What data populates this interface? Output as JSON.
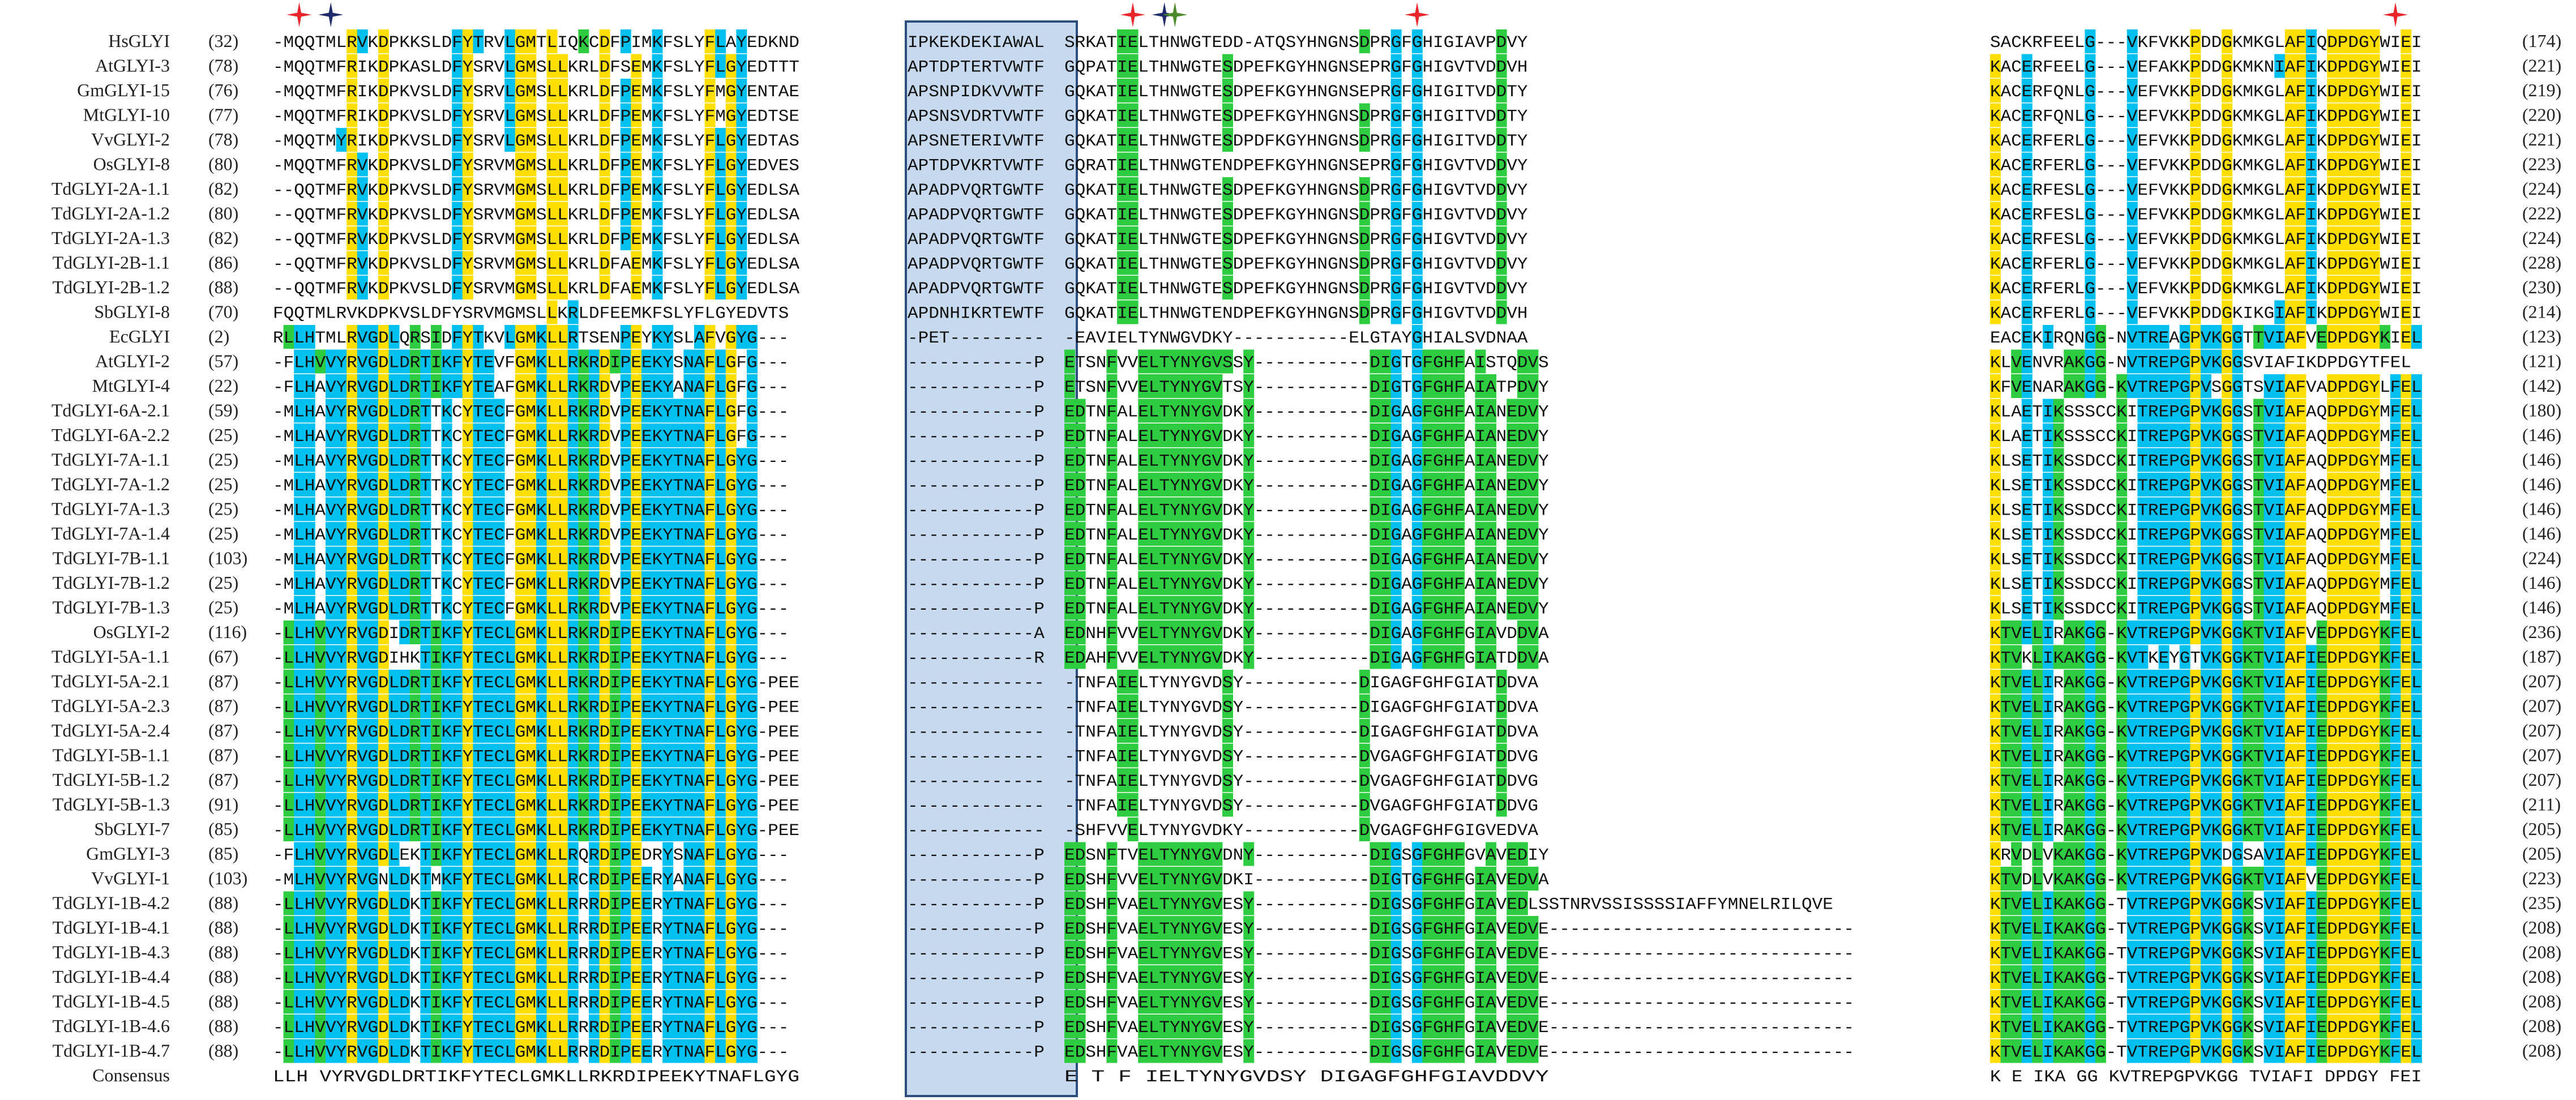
{
  "figure": {
    "labels": [
      "HsGLYI",
      "AtGLYI-3",
      "GmGLYI-15",
      "MtGLYI-10",
      "VvGLYI-2",
      "OsGLYI-8",
      "TdGLYI-2A-1.1",
      "TdGLYI-2A-1.2",
      "TdGLYI-2A-1.3",
      "TdGLYI-2B-1.1",
      "TdGLYI-2B-1.2",
      "SbGLYI-8",
      "EcGLYI",
      "AtGLYI-2",
      "MtGLYI-4",
      "TdGLYI-6A-2.1",
      "TdGLYI-6A-2.2",
      "TdGLYI-7A-1.1",
      "TdGLYI-7A-1.2",
      "TdGLYI-7A-1.3",
      "TdGLYI-7A-1.4",
      "TdGLYI-7B-1.1",
      "TdGLYI-7B-1.2",
      "TdGLYI-7B-1.3",
      "OsGLYI-2",
      "TdGLYI-5A-1.1",
      "TdGLYI-5A-2.1",
      "TdGLYI-5A-2.3",
      "TdGLYI-5A-2.4",
      "TdGLYI-5B-1.1",
      "TdGLYI-5B-1.2",
      "TdGLYI-5B-1.3",
      "SbGLYI-7",
      "GmGLYI-3",
      "VvGLYI-1",
      "TdGLYI-1B-4.2",
      "TdGLYI-1B-4.1",
      "TdGLYI-1B-4.3",
      "TdGLYI-1B-4.4",
      "TdGLYI-1B-4.5",
      "TdGLYI-1B-4.6",
      "TdGLYI-1B-4.7",
      "Consensus"
    ],
    "start_numbers": [
      "(32)",
      "(78)",
      "(76)",
      "(77)",
      "(78)",
      "(80)",
      "(82)",
      "(80)",
      "(82)",
      "(86)",
      "(88)",
      "(70)",
      "(2)",
      "(57)",
      "(22)",
      "(59)",
      "(25)",
      "(25)",
      "(25)",
      "(25)",
      "(25)",
      "(103)",
      "(25)",
      "(25)",
      "(116)",
      "(67)",
      "(87)",
      "(87)",
      "(87)",
      "(87)",
      "(87)",
      "(91)",
      "(85)",
      "(85)",
      "(103)",
      "(88)",
      "(88)",
      "(88)",
      "(88)",
      "(88)",
      "(88)",
      "(88)",
      ""
    ],
    "end_numbers": [
      "(174)",
      "(221)",
      "(219)",
      "(220)",
      "(221)",
      "(223)",
      "(224)",
      "(222)",
      "(224)",
      "(228)",
      "(230)",
      "(214)",
      "(123)",
      "(121)",
      "(142)",
      "(180)",
      "(146)",
      "(146)",
      "(146)",
      "(146)",
      "(146)",
      "(224)",
      "(146)",
      "(146)",
      "(236)",
      "(187)",
      "(207)",
      "(207)",
      "(207)",
      "(207)",
      "(207)",
      "(211)",
      "(205)",
      "(205)",
      "(223)",
      "(235)",
      "(208)",
      "(208)",
      "(208)",
      "(208)",
      "(208)",
      "(208)",
      ""
    ],
    "segments": {
      "s1": [
        "-MQQTMLRVKDPKKSLDFYTRVLGMTLIQKCDFPIMKFSLYFLAYEDKND",
        "-MQQTMFRIKDPKASLDFYSRVLGMSLLKRLDFSEMKFSLYFLGYEDTTT",
        "-MQQTMFRIKDPKVSLDFYSRVLGMSLLKRLDFPEMKFSLYFMGYENTAE",
        "-MQQTMFRIKDPKVSLDFYSRVLGMSLLKRLDFPEMKFSLYFMGYEDTSE",
        "-MQQTMYRIKDPKVSLDFYSRVLGMSLLKRLDFPEMKFSLYFLGYEDTAS",
        "-MQQTMFRVKDPKVSLDFYSRVMGMSLLKRLDFPEMKFSLYFLGYEDVES",
        "--QQTMFRVKDPKVSLDFYSRVMGMSLLKRLDFPEMKFSLYFLGYEDLSA",
        "--QQTMFRVKDPKVSLDFYSRVMGMSLLKRLDFPEMKFSLYFLGYEDLSA",
        "--QQTMFRVKDPKVSLDFYSRVMGMSLLKRLDFPEMKFSLYFLGYEDLSA",
        "--QQTMFRVKDPKVSLDFYSRVMGMSLLKRLDFAEMKFSLYFLGYEDLSA",
        "--QQTMFRVKDPKVSLDFYSRVMGMSLLKRLDFAEMKFSLYFLGYEDLSA",
        "FQQTMLRVKDPKVSLDFYSRVMGMSLLKRLDFEEMKFSLYFLGYEDVTS",
        "RLLHTMLRVGDLQRSIDFYTKVLGMKLLRTSENPEYKYSLAFVGYG---",
        "-FLHVVYRVGDLDRTIKFYTEVFGMKLLRKRDIPEEKYSNAFLGFG---",
        "-FLHAVYRVGDLDRTIKFYTEAFGMKLLRKRDVPEEKYANAFLGFG---",
        "-MLHAVYRVGDLDRTTKCYTECFGMKLLRKRDVPEEKYTNAFLGFG---",
        "-MLHAVYRVGDLDRTTKCYTECFGMKLLRKRDVPEEKYTNAFLGFG---",
        "-MLHAVYRVGDLDRTTKCYTECFGMKLLRKRDVPEEKYTNAFLGYG---",
        "-MLHAVYRVGDLDRTTKCYTECFGMKLLRKRDVPEEKYTNAFLGYG---",
        "-MLHAVYRVGDLDRTTKCYTECFGMKLLRKRDVPEEKYTNAFLGYG---",
        "-MLHAVYRVGDLDRTTKCYTECFGMKLLRKRDVPEEKYTNAFLGYG---",
        "-MLHAVYRVGDLDRTTKCYTECFGMKLLRKRDVPEEKYTNAFLGYG---",
        "-MLHAVYRVGDLDRTTKCYTECFGMKLLRKRDVPEEKYTNAFLGYG---",
        "-MLHAVYRVGDLDRTTKCYTECFGMKLLRKRDVPEEKYTNAFLGYG---",
        "-LLHVVYRVGDIDRTIKFYTECLGMKLLRKRDIPEEKYTNAFLGYG---",
        "-LLHVVYRVGDIHKTIKFYTECLGMKLLRKRDIPEEKYTNAFLGYG---",
        "-LLHVVYRVGDLDRTIKFYTECLGMKLLRKRDIPEEKYTNAFLGYG-PEE",
        "-LLHVVYRVGDLDRTIKFYTECLGMKLLRKRDIPEEKYTNAFLGYG-PEE",
        "-LLHVVYRVGDLDRTIKFYTECLGMKLLRKRDIPEEKYTNAFLGYG-PEE",
        "-LLHVVYRVGDLDRTIKFYTECLGMKLLRKRDIPEEKYTNAFLGYG-PEE",
        "-LLHVVYRVGDLDRTIKFYTECLGMKLLRKRDIPEEKYTNAFLGYG-PEE",
        "-LLHVVYRVGDLDRTIKFYTECLGMKLLRKRDIPEEKYTNAFLGYG-PEE",
        "-LLHVVYRVGDLDRTIKFYTECLGMKLLRKRDIPEEKYTNAFLGYG-PEE",
        "-FLHVVYRVGDLEKTIKFYTECLGMKLLRQRDIPEDRYSNAFLGYG---",
        "-MLHVVYRVGNLDKTMKFYTECLGMKLLRCRDIPEERYANAFLGYG---",
        "-LLHVVYRVGDLDKTIKFYTECLGMKLLRRRDIPEERYTNAFLGYG---",
        "-LLHVVYRVGDLDKTIKFYTECLGMKLLRRRDIPEERYTNAFLGYG---",
        "-LLHVVYRVGDLDKTIKFYTECLGMKLLRRRDIPEERYTNAFLGYG---",
        "-LLHVVYRVGDLDKTIKFYTECLGMKLLRRRDIPEERYTNAFLGYG---",
        "-LLHVVYRVGDLDKTIKFYTECLGMKLLRRRDIPEERYTNAFLGYG---",
        "-LLHVVYRVGDLDKTIKFYTECLGMKLLRRRDIPEERYTNAFLGYG---",
        "-LLHVVYRVGDLDKTIKFYTECLGMKLLRRRDIPEERYTNAFLGYG---",
        " LLH VYRVGDLDRTIKFYTECLGMKLLRKRDIPEEKYTNAFLGYG    "
      ],
      "box": [
        "IPKEKDEKIAWAL",
        "APTDPTERTVWTF",
        "APSNPIDKVVWTF",
        "APSNSVDRTVWTF",
        "APSNETERIVWTF",
        "APTDPVKRTVWTF",
        "APADPVQRTGWTF",
        "APADPVQRTGWTF",
        "APADPVQRTGWTF",
        "APADPVQRTGWTF",
        "APADPVQRTGWTF",
        "APDNHIKRTEWTF",
        "-PET---------",
        "------------P",
        "------------P",
        "------------P",
        "------------P",
        "------------P",
        "------------P",
        "------------P",
        "------------P",
        "------------P",
        "------------P",
        "------------P",
        "------------A",
        "------------R",
        "-------------",
        "-------------",
        "-------------",
        "-------------",
        "-------------",
        "-------------",
        "-------------",
        "------------P",
        "------------P",
        "------------P",
        "------------P",
        "------------P",
        "------------P",
        "------------P",
        "------------P",
        "------------P",
        "             "
      ],
      "s2": [
        "SRKATIELTHNWGTEDD-ATQSYHNGNSDPRGFGHIGIAVPDVY",
        "GQPATIELTHNWGTESDPEFKGYHNGNSEPRGFGHIGVTVDDVH",
        "GQKATIELTHNWGTESDPEFKGYHNGNSEPRGFGHIGITVDDTY",
        "GQKATIELTHNWGTESDPEFKGYHNGNSDPRGFGHIGITVDDTY",
        "GQKATIELTHNWGTESDPDFKGYHNGNSDPRGFGHIGITVDDTY",
        "GQRATIELTHNWGTENDPEFKGYHNGNSEPRGFGHIGVTVDDVY",
        "GQKATIELTHNWGTESDPEFKGYHNGNSDPRGFGHIGVTVDDVY",
        "GQKATIELTHNWGTESDPEFKGYHNGNSDPRGFGHIGVTVDDVY",
        "GQKATIELTHNWGTESDPEFKGYHNGNSDPRGFGHIGVTVDDVY",
        "GQKATIELTHNWGTESDPEFKGYHNGNSDPRGFGHIGVTVDDVY",
        "GQKATIELTHNWGTESDPEFKGYHNGNSDPRGFGHIGVTVDDVY",
        "GQKATIELTHNWGTENDPEFKGYHNGNSDPRGFGHIGVTVDDVH",
        "-EAVIELTYNWGVDKY-----------ELGTAYGHIALSVDNAA",
        "ETSNFVVELTYNYGVSSY-----------DIGTGFGHFAISTQDVS",
        "ETSNFVVELTYNYGVTSY-----------DIGTGFGHFAIATPDVY",
        "EDTNFALELTYNYGVDKY-----------DIGAGFGHFAIANEDVY",
        "EDTNFALELTYNYGVDKY-----------DIGAGFGHFAIANEDVY",
        "EDTNFALELTYNYGVDKY-----------DIGAGFGHFAIANEDVY",
        "EDTNFALELTYNYGVDKY-----------DIGAGFGHFAIANEDVY",
        "EDTNFALELTYNYGVDKY-----------DIGAGFGHFAIANEDVY",
        "EDTNFALELTYNYGVDKY-----------DIGAGFGHFAIANEDVY",
        "EDTNFALELTYNYGVDKY-----------DIGAGFGHFAIANEDVY",
        "EDTNFALELTYNYGVDKY-----------DIGAGFGHFAIANEDVY",
        "EDTNFALELTYNYGVDKY-----------DIGAGFGHFAIANEDVY",
        "EDNHFVVELTYNYGVDKY-----------DIGAGFGHFGIAVDDVA",
        "EDAHFVVELTYNYGVDKY-----------DIGAGFGHFGIATDDVA",
        "-TNFAIELTYNYGVDSY-----------DIGAGFGHFGIATDDVA",
        "-TNFAIELTYNYGVDSY-----------DIGAGFGHFGIATDDVA",
        "-TNFAIELTYNYGVDSY-----------DIGAGFGHFGIATDDVA",
        "-TNFAIELTYNYGVDSY-----------DVGAGFGHFGIATDDVG",
        "-TNFAIELTYNYGVDSY-----------DVGAGFGHFGIATDDVG",
        "-TNFAIELTYNYGVDSY-----------DVGAGFGHFGIATDDVG",
        "-SHFVVELTYNYGVDKY-----------DVGAGFGHFGIGVEDVA",
        "EDSNFTVELTYNYGVDNY-----------DIGSGFGHFGVAVEDIY",
        "EDSHFVVELTYNYGVDKI-----------DIGTGFGHFGIAVEDVA",
        "EDSHFVAELTYNYGVESY-----------DIGSGFGHFGIAVEDLSSTNRVSSISSSSIAFFYMNELRILQVE",
        "EDSHFVAELTYNYGVESY-----------DIGSGFGHFGIAVEDVE-----------------------------",
        "EDSHFVAELTYNYGVESY-----------DIGSGFGHFGIAVEDVE-----------------------------",
        "EDSHFVAELTYNYGVESY-----------DIGSGFGHFGIAVEDVE-----------------------------",
        "EDSHFVAELTYNYGVESY-----------DIGSGFGHFGIAVEDVE-----------------------------",
        "EDSHFVAELTYNYGVESY-----------DIGSGFGHFGIAVEDVE-----------------------------",
        "EDSHFVAELTYNYGVESY-----------DIGSGFGHFGIAVEDVE-----------------------------",
        "E T F IELTYNYGVDSY           DIGAGFGHFGIAVDDVY"
      ],
      "s3": [
        "SACKRFEELG---VKFVKKPDDGKMKGLAFIQDPDGYWIEI",
        "KACERFEELG---VEFAKKPDDGKMKNIAFIKDPDGYWIEI",
        "KACERFQNLG---VEFVKKPDDGKMKGLAFIKDPDGYWIEI",
        "KACERFQNLG---VEFVKKPDDGKMKGLAFIKDPDGYWIEI",
        "KACERFERLG---VEFVKKPDDGKMKGLAFIKDPDGYWIEI",
        "KACERFERLG---VEFVKKPDDGKMKGLAFIKDPDGYWIEI",
        "KACERFESLG---VEFVKKPDDGKMKGLAFIKDPDGYWIEI",
        "KACERFESLG---VEFVKKPDDGKMKGLAFIKDPDGYWIEI",
        "KACERFESLG---VEFVKKPDDGKMKGLAFIKDPDGYWIEI",
        "KACERFERLG---VEFVKKPDDGKMKGLAFIKDPDGYWIEI",
        "KACERFERLG---VEFVKKPDDGKMKGLAFIKDPDGYWIEI",
        "KACERFERLG---VEFVKKPDDGKIKGIAFIKDPDGYWIEI",
        "EACEKIRQNGG-NVTREAGPVKGGTTVIAFVEDPDGYKIEL",
        "KLVENVRAKGG-NVTREPGPVKGGSVIAFIKDPDGYTFEL",
        "KFVENARAKGG-KVTREPGPVSGGTSVIAFVADPDGYLFEL",
        "KLAETIKSSSCCKITREPGPVKGGSTVIAFAQDPDGYMFEL",
        "KLAETIKSSSCCKITREPGPVKGGSTVIAFAQDPDGYMFEL",
        "KLSETIKSSDCCKITREPGPVKGGSTVIAFAQDPDGYMFEL",
        "KLSETIKSSDCCKITREPGPVKGGSTVIAFAQDPDGYMFEL",
        "KLSETIKSSDCCKITREPGPVKGGSTVIAFAQDPDGYMFEL",
        "KLSETIKSSDCCKITREPGPVKGGSTVIAFAQDPDGYMFEL",
        "KLSETIKSSDCCKITREPGPVKGGSTVIAFAQDPDGYMFEL",
        "KLSETIKSSDCCKITREPGPVKGGSTVIAFAQDPDGYMFEL",
        "KLSETIKSSDCCKITREPGPVKGGSTVIAFAQDPDGYMFEL",
        "KTVELIRAKGG-KVTREPGPVKGGKTVIAFVEDPDGYKFEL",
        "KTVKLIKAKGG-KVTKEYGTVKGGKTVIAFIEDPDGYKFEL",
        "KTVELIRAKGG-KVTREPGPVKGGKTVIAFIEDPDGYKFEL",
        "KTVELIRAKGG-KVTREPGPVKGGKTVIAFIEDPDGYKFEL",
        "KTVELIRAKGG-KVTREPGPVKGGKTVIAFIEDPDGYKFEL",
        "KTVELIRAKGG-KVTREPGPVKGGKTVIAFIEDPDGYKFEL",
        "KTVELIRAKGG-KVTREPGPVKGGKTVIAFIEDPDGYKFEL",
        "KTVELIRAKGG-KVTREPGPVKGGKTVIAFIEDPDGYKFEL",
        "KTVELIRAKGG-KVTREPGPVKGGKTVIAFIEDPDGYKFEL",
        "KRVDLVKAKGG-KVTREPGPVKDGSAVIAFIEDPDGYKFEL",
        "KTVDLVKAKGG-KVTREPGPVKGGKTVIAFVEDPDGYKFEL",
        "KTVELIKAKGG-TVTREPGPVKGGKSVIAFIEDPDGYKFEL",
        "KTVELIKAKGG-TVTREPGPVKGGKSVIAFIEDPDGYKFEL",
        "KTVELIKAKGG-TVTREPGPVKGGKSVIAFIEDPDGYKFEL",
        "KTVELIKAKGG-TVTREPGPVKGGKSVIAFIEDPDGYKFEL",
        "KTVELIKAKGG-TVTREPGPVKGGKSVIAFIEDPDGYKFEL",
        "KTVELIKAKGG-TVTREPGPVKGGKSVIAFIEDPDGYKFEL",
        "KTVELIKAKGG-TVTREPGPVKGGKSVIAFIEDPDGYKFEL",
        "K  E IKA GG KVTREPGPVKGG TVIAFI DPDGY FEI"
      ]
    },
    "residue_colors": {
      "identical": "#ffde00",
      "conserved": "#00c0f0",
      "similar": "#2ecc40",
      "box_fill": "#c6d9ee",
      "box_border": "#2e4f7e"
    },
    "marker_colors": {
      "red_star": "#e8262b",
      "navy_star": "#1f2b6b",
      "green_star": "#4a8a2a"
    },
    "markers": [
      {
        "color": "red",
        "segment": "s1",
        "col": 2
      },
      {
        "color": "navy",
        "segment": "s1",
        "col": 5
      },
      {
        "color": "red",
        "segment": "s2",
        "col": 6
      },
      {
        "color": "navy",
        "segment": "s2",
        "col": 9
      },
      {
        "color": "green",
        "segment": "s2",
        "col": 10
      },
      {
        "color": "red",
        "segment": "s2",
        "col": 33
      },
      {
        "color": "red",
        "segment": "s3",
        "col": 38
      }
    ]
  }
}
